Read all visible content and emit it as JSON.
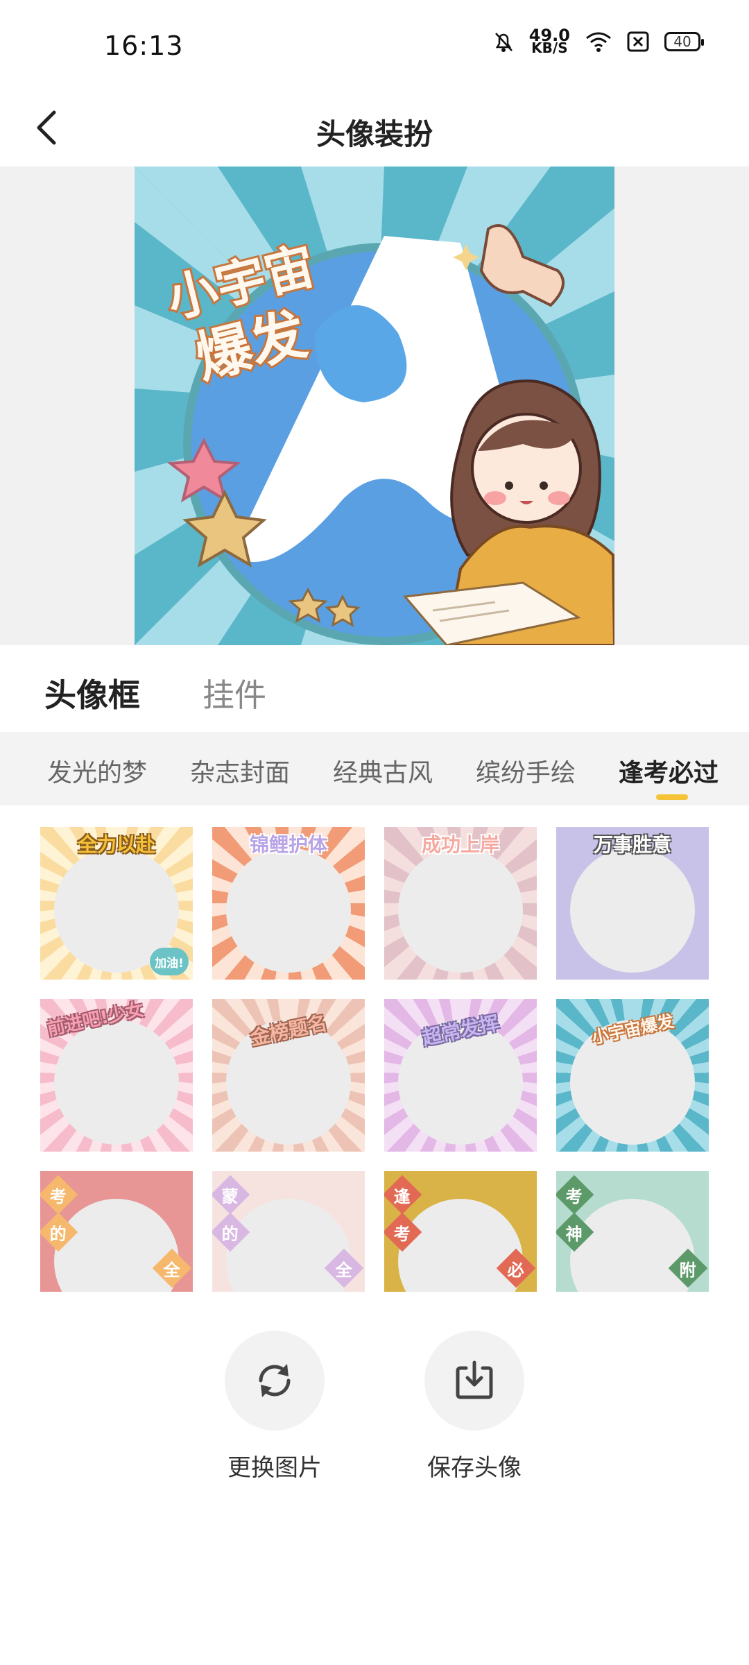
{
  "status": {
    "time": "16:13",
    "net_speed": "49.0",
    "net_unit": "KB/S",
    "battery": "40"
  },
  "header": {
    "title": "头像装扮"
  },
  "preview": {
    "banner_line1": "小宇宙",
    "banner_line2": "爆发"
  },
  "tabs": [
    {
      "label": "头像框"
    },
    {
      "label": "挂件"
    }
  ],
  "categories": [
    {
      "label": "发光的梦"
    },
    {
      "label": "杂志封面"
    },
    {
      "label": "经典古风"
    },
    {
      "label": "缤纷手绘"
    },
    {
      "label": "逢考必过"
    }
  ],
  "frames": [
    {
      "label": "全力以赴",
      "badge": "加油!"
    },
    {
      "label": "锦鲤护体"
    },
    {
      "label": "成功上岸"
    },
    {
      "label": "万事胜意"
    },
    {
      "label": "前进吧!少女"
    },
    {
      "label": "金榜题名"
    },
    {
      "label": "超常发挥"
    },
    {
      "label": "小宇宙爆发"
    },
    {
      "chars": [
        "考",
        "的",
        "全"
      ]
    },
    {
      "chars": [
        "蒙",
        "的",
        "全"
      ]
    },
    {
      "chars": [
        "逢",
        "考",
        "必"
      ]
    },
    {
      "chars": [
        "考",
        "神",
        "附"
      ]
    }
  ],
  "actions": {
    "change_image": "更换图片",
    "save_avatar": "保存头像"
  }
}
